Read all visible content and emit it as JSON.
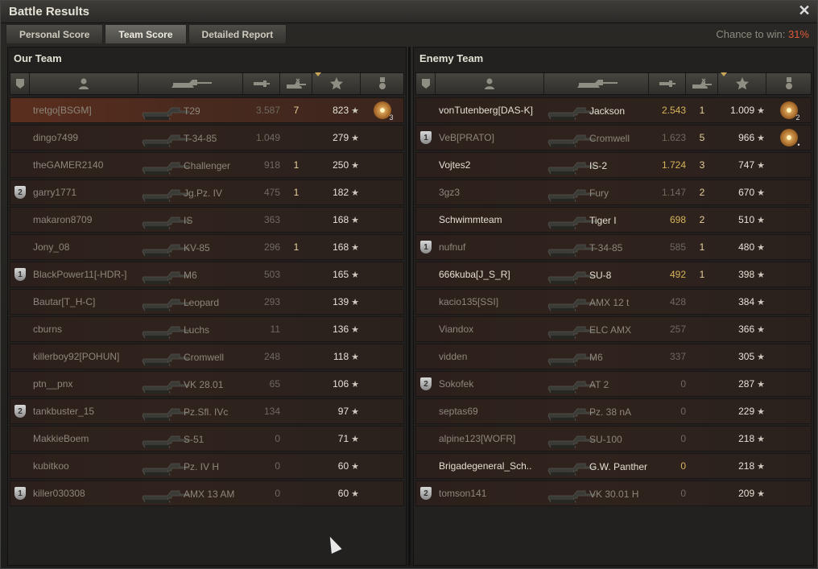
{
  "window": {
    "title": "Battle Results",
    "close_label": "✕"
  },
  "tabs": [
    {
      "label": "Personal Score",
      "active": false
    },
    {
      "label": "Team Score",
      "active": true
    },
    {
      "label": "Detailed Report",
      "active": false
    }
  ],
  "chance": {
    "label": "Chance to win:",
    "value": "31%"
  },
  "our_team": {
    "title": "Our Team",
    "rows": [
      {
        "badge": "",
        "name": "tretgo[BSGM]",
        "tank": "T29",
        "damage": "3.587",
        "kills": "7",
        "xp": "823",
        "medal": "3",
        "self": true,
        "alive": false,
        "dmg_hi": false
      },
      {
        "badge": "",
        "name": "dingo7499",
        "tank": "T-34-85",
        "damage": "1.049",
        "kills": "",
        "xp": "279",
        "medal": "",
        "self": false,
        "alive": false,
        "dmg_hi": false
      },
      {
        "badge": "",
        "name": "theGAMER2140",
        "tank": "Challenger",
        "damage": "918",
        "kills": "1",
        "xp": "250",
        "medal": "",
        "self": false,
        "alive": false,
        "dmg_hi": false
      },
      {
        "badge": "2",
        "name": "garry1771",
        "tank": "Jg.Pz. IV",
        "damage": "475",
        "kills": "1",
        "xp": "182",
        "medal": "",
        "self": false,
        "alive": false,
        "dmg_hi": false
      },
      {
        "badge": "",
        "name": "makaron8709",
        "tank": "IS",
        "damage": "363",
        "kills": "",
        "xp": "168",
        "medal": "",
        "self": false,
        "alive": false,
        "dmg_hi": false
      },
      {
        "badge": "",
        "name": "Jony_08",
        "tank": "KV-85",
        "damage": "296",
        "kills": "1",
        "xp": "168",
        "medal": "",
        "self": false,
        "alive": false,
        "dmg_hi": false
      },
      {
        "badge": "1",
        "name": "BlackPower11[-HDR-]",
        "tank": "M6",
        "damage": "503",
        "kills": "",
        "xp": "165",
        "medal": "",
        "self": false,
        "alive": false,
        "dmg_hi": false
      },
      {
        "badge": "",
        "name": "Bautar[T_H-C]",
        "tank": "Leopard",
        "damage": "293",
        "kills": "",
        "xp": "139",
        "medal": "",
        "self": false,
        "alive": false,
        "dmg_hi": false
      },
      {
        "badge": "",
        "name": "cburns",
        "tank": "Luchs",
        "damage": "11",
        "kills": "",
        "xp": "136",
        "medal": "",
        "self": false,
        "alive": false,
        "dmg_hi": false
      },
      {
        "badge": "",
        "name": "killerboy92[POHUN]",
        "tank": "Cromwell",
        "damage": "248",
        "kills": "",
        "xp": "118",
        "medal": "",
        "self": false,
        "alive": false,
        "dmg_hi": false
      },
      {
        "badge": "",
        "name": "ptn__pnx",
        "tank": "VK 28.01",
        "damage": "65",
        "kills": "",
        "xp": "106",
        "medal": "",
        "self": false,
        "alive": false,
        "dmg_hi": false
      },
      {
        "badge": "2",
        "name": "tankbuster_15",
        "tank": "Pz.Sfl. IVc",
        "damage": "134",
        "kills": "",
        "xp": "97",
        "medal": "",
        "self": false,
        "alive": false,
        "dmg_hi": false
      },
      {
        "badge": "",
        "name": "MakkieBoem",
        "tank": "S-51",
        "damage": "0",
        "kills": "",
        "xp": "71",
        "medal": "",
        "self": false,
        "alive": false,
        "dmg_hi": false
      },
      {
        "badge": "",
        "name": "kubitkoo",
        "tank": "Pz. IV H",
        "damage": "0",
        "kills": "",
        "xp": "60",
        "medal": "",
        "self": false,
        "alive": false,
        "dmg_hi": false
      },
      {
        "badge": "1",
        "name": "killer030308",
        "tank": "AMX 13 AM",
        "damage": "0",
        "kills": "",
        "xp": "60",
        "medal": "",
        "self": false,
        "alive": false,
        "dmg_hi": false
      }
    ]
  },
  "enemy_team": {
    "title": "Enemy Team",
    "rows": [
      {
        "badge": "",
        "name": "vonTutenberg[DAS-K]",
        "tank": "Jackson",
        "damage": "2.543",
        "kills": "1",
        "xp": "1.009",
        "medal": "2",
        "self": false,
        "alive": true,
        "dmg_hi": true
      },
      {
        "badge": "1",
        "name": "VeB[PRATO]",
        "tank": "Cromwell",
        "damage": "1.623",
        "kills": "5",
        "xp": "966",
        "medal": "•",
        "self": false,
        "alive": false,
        "dmg_hi": false
      },
      {
        "badge": "",
        "name": "Vojtes2",
        "tank": "IS-2",
        "damage": "1.724",
        "kills": "3",
        "xp": "747",
        "medal": "",
        "self": false,
        "alive": true,
        "dmg_hi": true
      },
      {
        "badge": "",
        "name": "3gz3",
        "tank": "Fury",
        "damage": "1.147",
        "kills": "2",
        "xp": "670",
        "medal": "",
        "self": false,
        "alive": false,
        "dmg_hi": false
      },
      {
        "badge": "",
        "name": "Schwimmteam",
        "tank": "Tiger I",
        "damage": "698",
        "kills": "2",
        "xp": "510",
        "medal": "",
        "self": false,
        "alive": true,
        "dmg_hi": true
      },
      {
        "badge": "1",
        "name": "nufnuf",
        "tank": "T-34-85",
        "damage": "585",
        "kills": "1",
        "xp": "480",
        "medal": "",
        "self": false,
        "alive": false,
        "dmg_hi": false
      },
      {
        "badge": "",
        "name": "666kuba[J_S_R]",
        "tank": "SU-8",
        "damage": "492",
        "kills": "1",
        "xp": "398",
        "medal": "",
        "self": false,
        "alive": true,
        "dmg_hi": true
      },
      {
        "badge": "",
        "name": "kacio135[SSI]",
        "tank": "AMX 12 t",
        "damage": "428",
        "kills": "",
        "xp": "384",
        "medal": "",
        "self": false,
        "alive": false,
        "dmg_hi": false
      },
      {
        "badge": "",
        "name": "Viandox",
        "tank": "ELC AMX",
        "damage": "257",
        "kills": "",
        "xp": "366",
        "medal": "",
        "self": false,
        "alive": false,
        "dmg_hi": false
      },
      {
        "badge": "",
        "name": "vidden",
        "tank": "M6",
        "damage": "337",
        "kills": "",
        "xp": "305",
        "medal": "",
        "self": false,
        "alive": false,
        "dmg_hi": false
      },
      {
        "badge": "2",
        "name": "Sokofek",
        "tank": "AT 2",
        "damage": "0",
        "kills": "",
        "xp": "287",
        "medal": "",
        "self": false,
        "alive": false,
        "dmg_hi": false
      },
      {
        "badge": "",
        "name": "septas69",
        "tank": "Pz. 38 nA",
        "damage": "0",
        "kills": "",
        "xp": "229",
        "medal": "",
        "self": false,
        "alive": false,
        "dmg_hi": false
      },
      {
        "badge": "",
        "name": "alpine123[WOFR]",
        "tank": "SU-100",
        "damage": "0",
        "kills": "",
        "xp": "218",
        "medal": "",
        "self": false,
        "alive": false,
        "dmg_hi": false
      },
      {
        "badge": "",
        "name": "Brigadegeneral_Sch..",
        "tank": "G.W. Panther",
        "damage": "0",
        "kills": "",
        "xp": "218",
        "medal": "",
        "self": false,
        "alive": true,
        "dmg_hi": true
      },
      {
        "badge": "2",
        "name": "tomson141",
        "tank": "VK 30.01 H",
        "damage": "0",
        "kills": "",
        "xp": "209",
        "medal": "",
        "self": false,
        "alive": false,
        "dmg_hi": false
      }
    ]
  },
  "icons": {
    "star": "★",
    "column_icons": [
      "platoon-icon",
      "player-icon",
      "tank-icon",
      "damage-icon",
      "kills-icon",
      "xp-icon",
      "medal-icon"
    ]
  },
  "colors": {
    "accent": "#e05a3a",
    "highlight_damage": "#d7b45a",
    "self_row": "#5a2e1e"
  }
}
